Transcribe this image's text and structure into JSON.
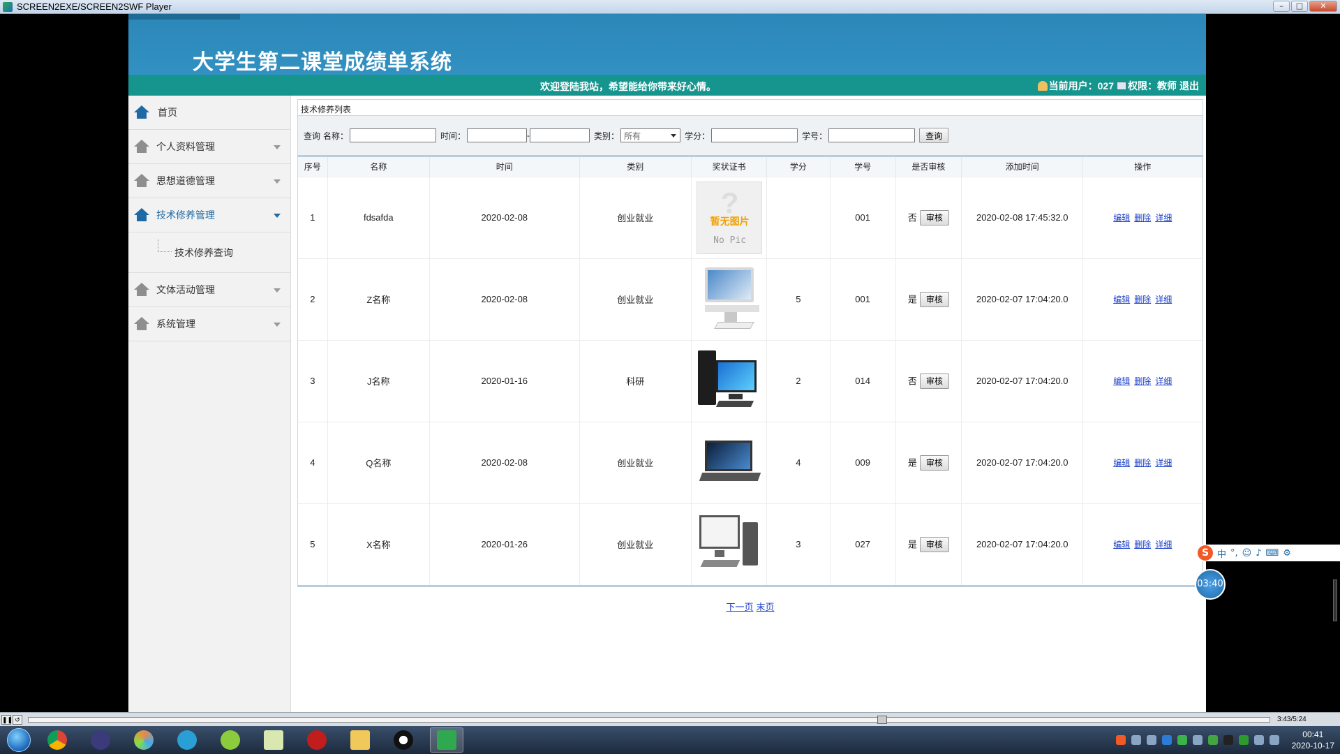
{
  "player": {
    "title": "SCREEN2EXE/SCREEN2SWF Player",
    "time": "3:43/5:24"
  },
  "site": {
    "title": "大学生第二课堂成绩单系统",
    "welcome": "欢迎登陆我站，希望能给你带来好心情。",
    "user_label": "当前用户：",
    "user_value": "027",
    "perm_label": "权限：",
    "perm_value": "教师",
    "logout": "退出"
  },
  "sidebar": {
    "home": "首页",
    "items": [
      {
        "label": "个人资料管理"
      },
      {
        "label": "思想道德管理"
      },
      {
        "label": "技术修养管理"
      },
      {
        "label": "文体活动管理"
      },
      {
        "label": "系统管理"
      }
    ],
    "sub_item": "技术修养查询"
  },
  "panel": {
    "title": "技术修养列表"
  },
  "query": {
    "prefix": "查询",
    "name_label": "名称：",
    "time_label": "时间：",
    "type_label": "类别：",
    "type_value": "所有",
    "credit_label": "学分：",
    "id_label": "学号：",
    "button": "查询",
    "dash": "-"
  },
  "table": {
    "headers": [
      "序号",
      "名称",
      "时间",
      "类别",
      "奖状证书",
      "学分",
      "学号",
      "是否审核",
      "添加时间",
      "操作"
    ],
    "audit_button": "审核",
    "ops": [
      "编辑",
      "删除",
      "详细"
    ],
    "rows": [
      {
        "no": "1",
        "name": "fdsafda",
        "date": "2020-02-08",
        "type": "创业就业",
        "pic": "nopic",
        "credit": "",
        "sid": "001",
        "audited": "否",
        "added": "2020-02-08 17:45:32.0"
      },
      {
        "no": "2",
        "name": "Z名称",
        "date": "2020-02-08",
        "type": "创业就业",
        "pic": "imac",
        "credit": "5",
        "sid": "001",
        "audited": "是",
        "added": "2020-02-07 17:04:20.0"
      },
      {
        "no": "3",
        "name": "J名称",
        "date": "2020-01-16",
        "type": "科研",
        "pic": "desktop",
        "credit": "2",
        "sid": "014",
        "audited": "否",
        "added": "2020-02-07 17:04:20.0"
      },
      {
        "no": "4",
        "name": "Q名称",
        "date": "2020-02-08",
        "type": "创业就业",
        "pic": "laptop",
        "credit": "4",
        "sid": "009",
        "audited": "是",
        "added": "2020-02-07 17:04:20.0"
      },
      {
        "no": "5",
        "name": "X名称",
        "date": "2020-01-26",
        "type": "创业就业",
        "pic": "tower",
        "credit": "3",
        "sid": "027",
        "audited": "是",
        "added": "2020-02-07 17:04:20.0"
      }
    ],
    "nopic_text": "暂无图片",
    "nopic_sub": "No Pic"
  },
  "pager": {
    "next": "下一页",
    "last": "末页"
  },
  "overlay": {
    "timer": "03:40",
    "ime_lang": "中"
  },
  "clock": {
    "time": "00:41",
    "date": "2020-10-17"
  }
}
